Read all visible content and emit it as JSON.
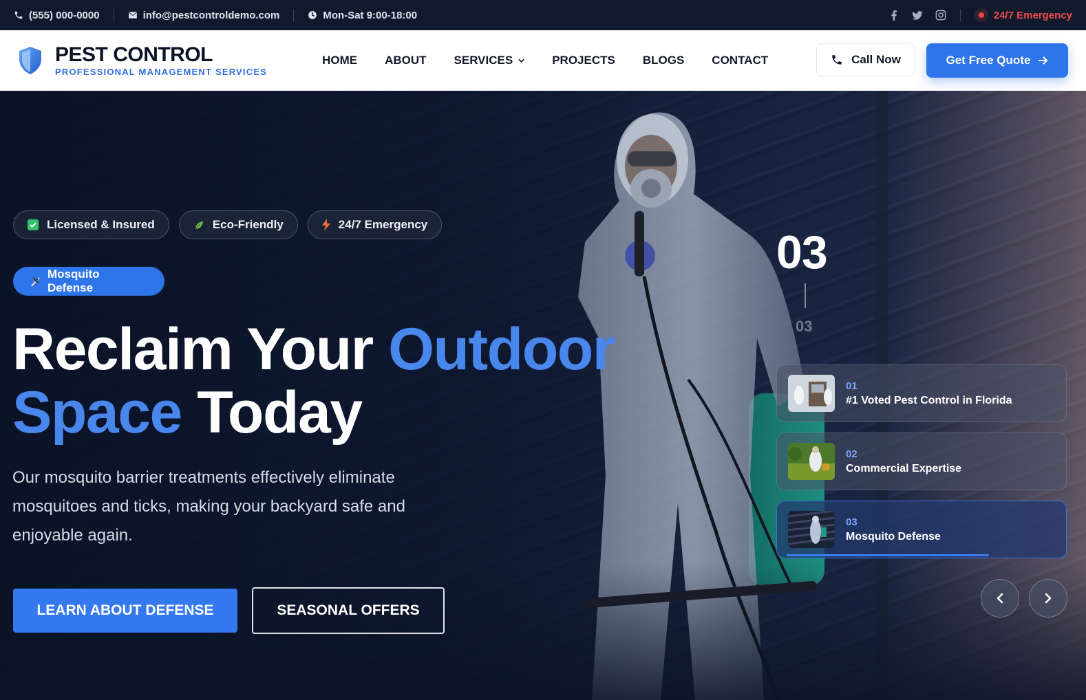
{
  "topbar": {
    "phone": "(555) 000-0000",
    "email": "info@pestcontroldemo.com",
    "hours": "Mon-Sat 9:00-18:00",
    "emergency": "24/7 Emergency"
  },
  "header": {
    "logo_title": "PEST CONTROL",
    "logo_subtitle": "PROFESSIONAL MANAGEMENT SERVICES",
    "nav": [
      "HOME",
      "ABOUT",
      "SERVICES",
      "PROJECTS",
      "BLOGS",
      "CONTACT"
    ],
    "call_label": "Call Now",
    "quote_label": "Get Free Quote"
  },
  "hero": {
    "badges": [
      "Licensed & Insured",
      "Eco-Friendly",
      "24/7 Emergency"
    ],
    "tag": "Mosquito Defense",
    "headline_part1": "Reclaim Your ",
    "headline_part2": "Outdoor",
    "headline_part3": "Space",
    "headline_part4": " Today",
    "description": "Our mosquito barrier treatments effectively eliminate mosquitoes and ticks, making your backyard safe and enjoyable again.",
    "primary_button": "LEARN ABOUT DEFENSE",
    "secondary_button": "SEASONAL OFFERS",
    "counter_current": "03",
    "counter_total": "03",
    "slides": [
      {
        "num": "01",
        "title": "#1 Voted Pest Control in Florida"
      },
      {
        "num": "02",
        "title": "Commercial Expertise"
      },
      {
        "num": "03",
        "title": "Mosquito Defense"
      }
    ],
    "active_slide_progress": 0.7
  },
  "colors": {
    "accent": "#2f75ea",
    "topbar_bg": "#111a2d",
    "emergency": "#ef4444"
  }
}
